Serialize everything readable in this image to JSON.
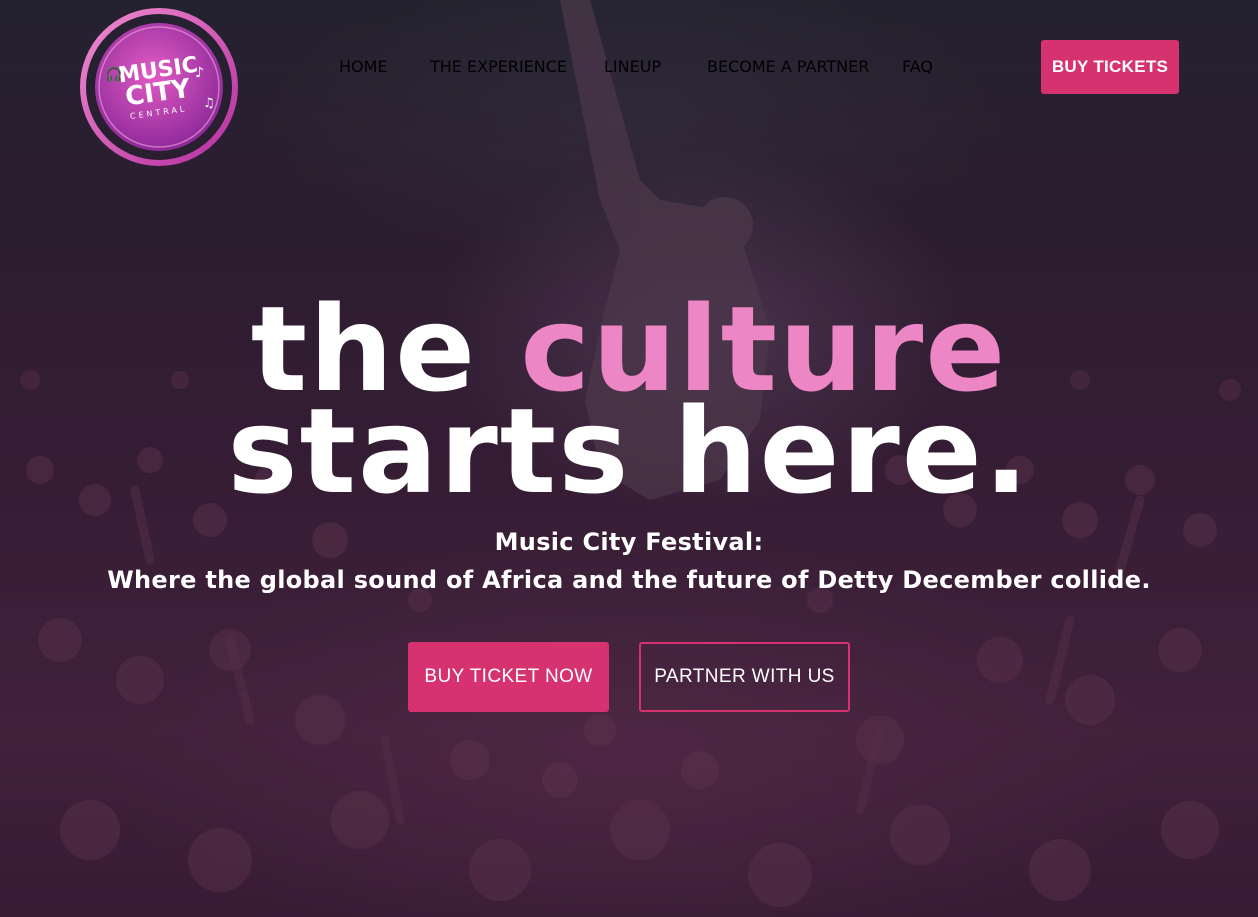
{
  "brand": {
    "logo_line1": "MUSIC",
    "logo_line2": "CITY",
    "logo_line3": "CENTRAL",
    "accent_color": "#e56fb8",
    "button_color": "#d6326f"
  },
  "nav": {
    "items": [
      {
        "label": "HOME",
        "active": true
      },
      {
        "label": "THE EXPERIENCE",
        "active": false
      },
      {
        "label": "LINEUP",
        "active": false
      },
      {
        "label": "BECOME A PARTNER",
        "active": false
      },
      {
        "label": "FAQ",
        "active": false
      }
    ],
    "cta_label": "BUY TICKETS"
  },
  "hero": {
    "headline_word1": "the",
    "headline_word2": "culture",
    "headline_word3": "starts",
    "headline_word4": "here.",
    "subtitle_line1": "Music City Festival:",
    "subtitle_line2": "Where the global sound of Africa and the future of Detty December collide.",
    "primary_button": "BUY TICKET NOW",
    "secondary_button": "PARTNER WITH US"
  }
}
